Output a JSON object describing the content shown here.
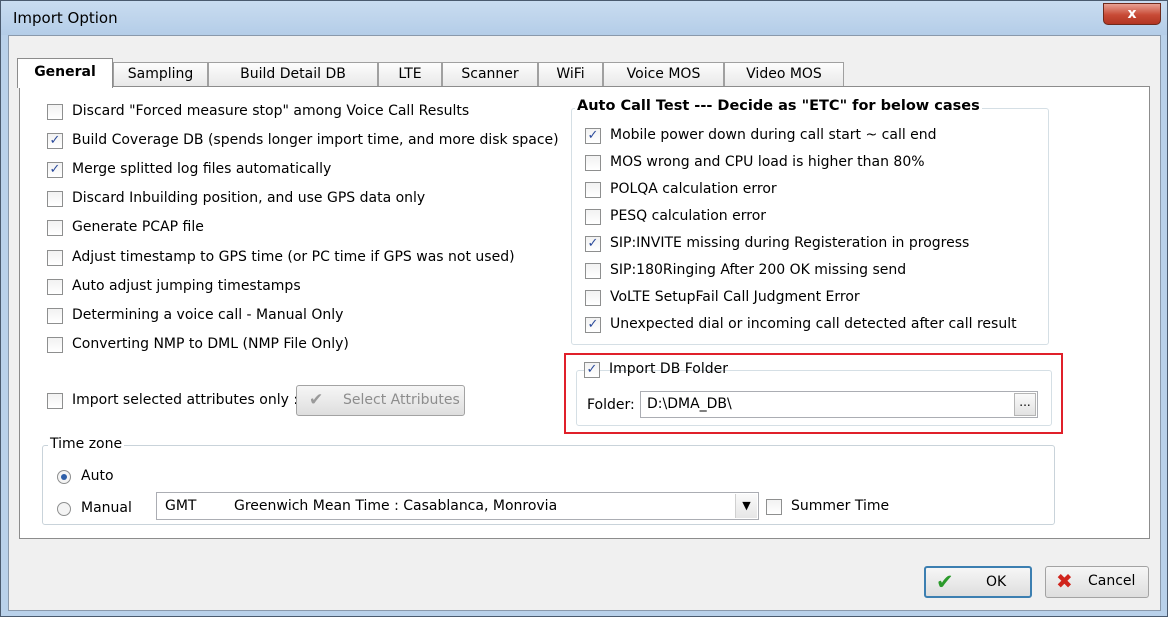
{
  "window": {
    "title": "Import Option",
    "close_label": "x"
  },
  "tabs": [
    {
      "label": "General",
      "active": true
    },
    {
      "label": "Sampling"
    },
    {
      "label": "Build Detail DB"
    },
    {
      "label": "LTE"
    },
    {
      "label": "Scanner"
    },
    {
      "label": "WiFi"
    },
    {
      "label": "Voice MOS"
    },
    {
      "label": "Video MOS"
    }
  ],
  "general": {
    "options": [
      {
        "label": "Discard \"Forced measure stop\" among Voice Call Results",
        "checked": false
      },
      {
        "label": "Build Coverage DB (spends longer import time, and more disk space)",
        "checked": true
      },
      {
        "label": "Merge splitted log files automatically",
        "checked": true
      },
      {
        "label": "Discard Inbuilding position, and use GPS data only",
        "checked": false
      },
      {
        "label": "Generate PCAP file",
        "checked": false
      },
      {
        "label": "Adjust timestamp to GPS time (or PC time if GPS was not used)",
        "checked": false
      },
      {
        "label": "Auto adjust jumping timestamps",
        "checked": false
      },
      {
        "label": "Determining a voice call - Manual Only",
        "checked": false
      },
      {
        "label": "Converting NMP to DML (NMP File  Only)",
        "checked": false
      }
    ],
    "import_selected": {
      "label": "Import selected attributes only :",
      "checked": false
    },
    "select_attributes_label": "Select Attributes"
  },
  "auto_call_test": {
    "title": "Auto Call Test --- Decide as \"ETC\" for below cases",
    "options": [
      {
        "label": "Mobile power down during call start ~ call end",
        "checked": true
      },
      {
        "label": "MOS wrong and CPU load is higher than 80%",
        "checked": false
      },
      {
        "label": "POLQA calculation error",
        "checked": false
      },
      {
        "label": "PESQ calculation error",
        "checked": false
      },
      {
        "label": "SIP:INVITE missing during Registeration in progress",
        "checked": true
      },
      {
        "label": "SIP:180Ringing After 200 OK missing send",
        "checked": false
      },
      {
        "label": "VoLTE SetupFail Call Judgment Error",
        "checked": false
      },
      {
        "label": "Unexpected dial or incoming call detected after call result",
        "checked": true
      }
    ]
  },
  "import_db": {
    "label": "Import DB Folder",
    "checked": true,
    "folder_label": "Folder:",
    "folder_value": "D:\\DMA_DB\\",
    "browse_label": "..."
  },
  "timezone": {
    "title": "Time zone",
    "auto_label": "Auto",
    "manual_label": "Manual",
    "selected": "auto",
    "zone_code": "GMT",
    "zone_name": "Greenwich Mean Time : Casablanca, Monrovia",
    "summer_time_label": "Summer Time",
    "summer_time_checked": false
  },
  "footer": {
    "ok_label": "OK",
    "cancel_label": "Cancel"
  },
  "colors": {
    "highlight_box": "#e0202a",
    "check_accent": "#2b4a9b"
  }
}
